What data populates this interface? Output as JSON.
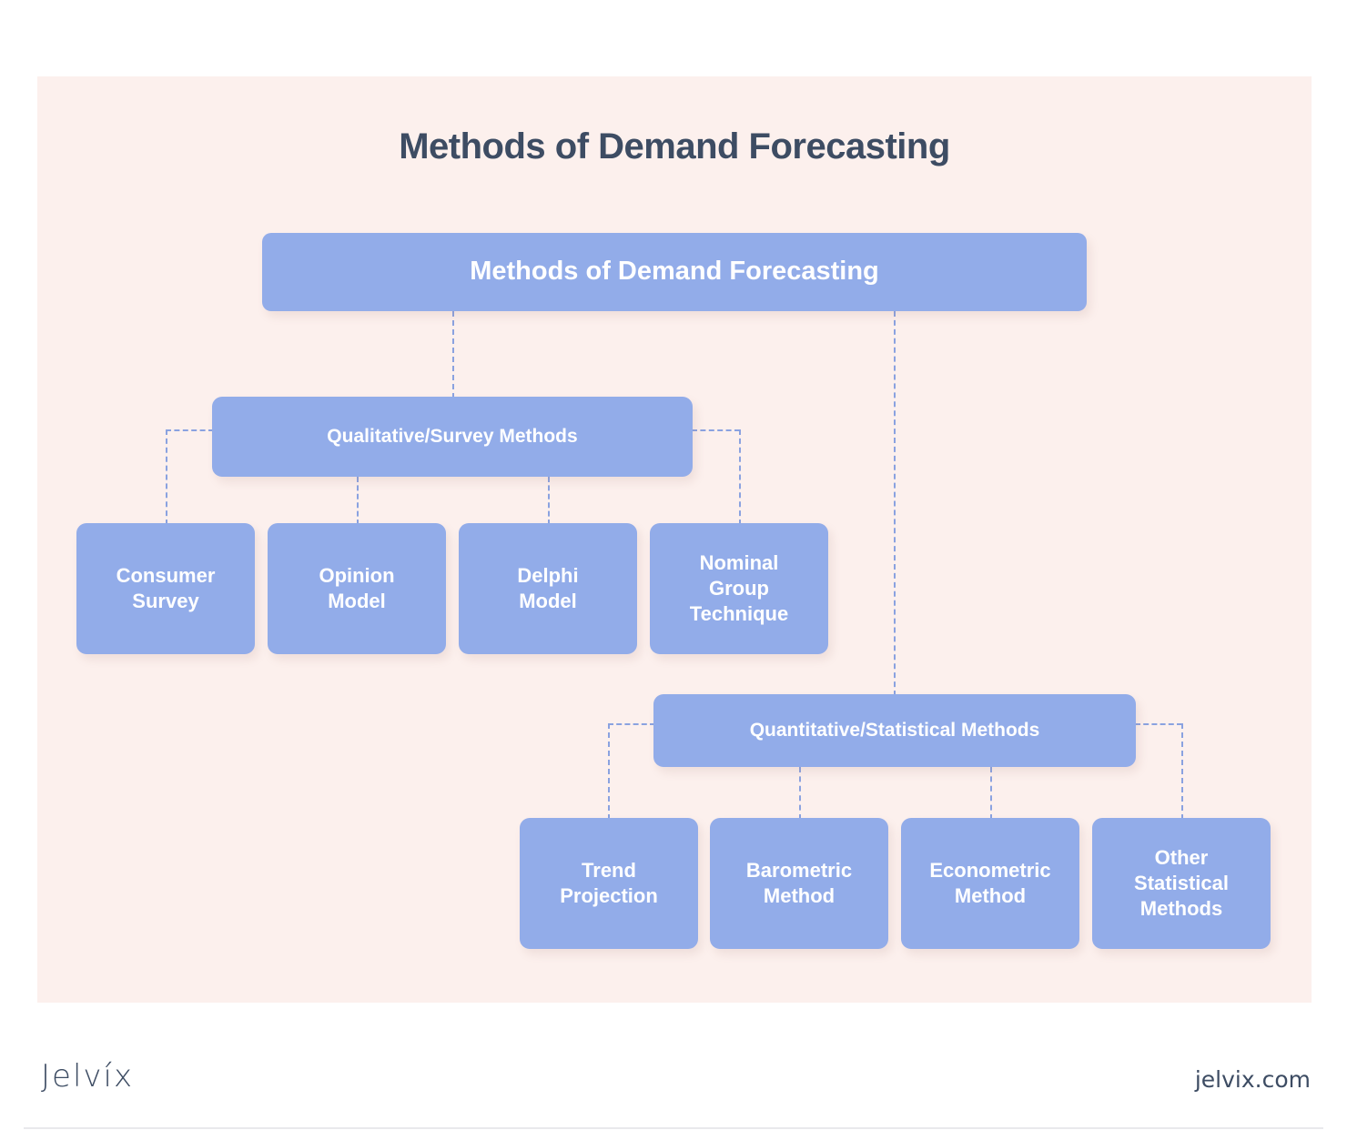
{
  "page": {
    "title": "Methods of Demand Forecasting",
    "background_color": "#ffffff",
    "panel_color": "#fcf0ed",
    "node_color": "#92ace9",
    "node_text_color": "#ffffff",
    "title_color": "#3d4c63",
    "connector_color": "#8aa2e0"
  },
  "diagram": {
    "type": "tree",
    "root": {
      "label": "Methods of Demand Forecasting"
    },
    "branches": [
      {
        "id": "qualitative",
        "label": "Qualitative/Survey Methods",
        "children": [
          {
            "id": "consumer-survey",
            "label": "Consumer\nSurvey"
          },
          {
            "id": "opinion-model",
            "label": "Opinion\nModel"
          },
          {
            "id": "delphi-model",
            "label": "Delphi\nModel"
          },
          {
            "id": "nominal-group-technique",
            "label": "Nominal\nGroup\nTechnique"
          }
        ]
      },
      {
        "id": "quantitative",
        "label": "Quantitative/Statistical Methods",
        "children": [
          {
            "id": "trend-projection",
            "label": "Trend\nProjection"
          },
          {
            "id": "barometric-method",
            "label": "Barometric\nMethod"
          },
          {
            "id": "econometric-method",
            "label": "Econometric\nMethod"
          },
          {
            "id": "other-statistical-methods",
            "label": "Other\nStatistical\nMethods"
          }
        ]
      }
    ]
  },
  "footer": {
    "logo": "Jelvíx",
    "url": "jelvix.com"
  }
}
